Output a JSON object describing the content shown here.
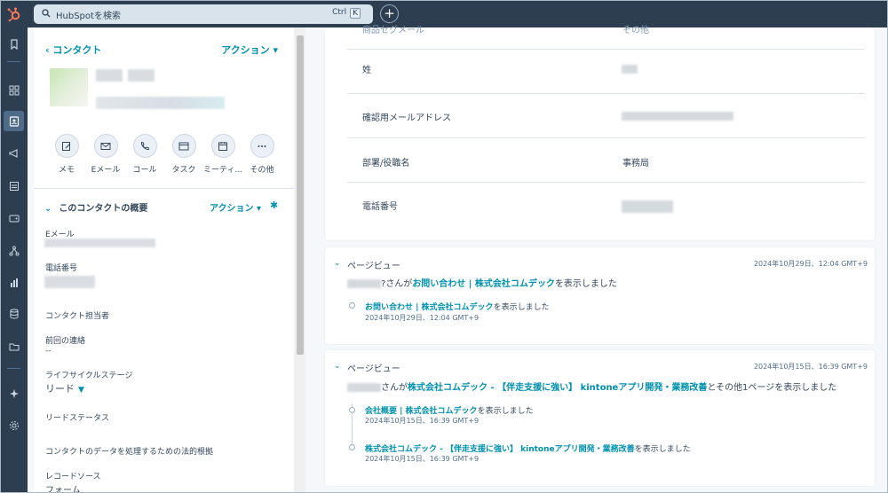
{
  "topbar": {
    "search_placeholder": "HubSpotを検索",
    "shortcut_ctrl": "Ctrl",
    "shortcut_key": "K",
    "add_label": "+"
  },
  "contact": {
    "back_label": "‹ コンタクト",
    "actions_label": "アクション ▾",
    "quick_actions": [
      {
        "label": "メモ",
        "icon": "pencil-icon"
      },
      {
        "label": "Eメール",
        "icon": "envelope-icon"
      },
      {
        "label": "コール",
        "icon": "phone-icon"
      },
      {
        "label": "タスク",
        "icon": "task-icon"
      },
      {
        "label": "ミーティ...",
        "icon": "calendar-icon"
      },
      {
        "label": "その他",
        "icon": "more-icon"
      }
    ]
  },
  "summary": {
    "title": "このコンタクトの概要",
    "actions_label": "アクション ▾",
    "props": {
      "email_label": "Eメール",
      "phone_label": "電話番号",
      "owner_label": "コンタクト担当者",
      "last_contact_label": "前回の連絡",
      "last_contact_value": "--",
      "lifecycle_label": "ライフサイクルステージ",
      "lifecycle_value": "リード",
      "lead_status_label": "リードステータス",
      "legal_basis_label": "コンタクトのデータを処理するための法的根拠",
      "record_source_label": "レコードソース",
      "record_source_value": "フォーム"
    }
  },
  "details": {
    "top_label": "商品セグメール",
    "top_value": "その他",
    "rows": [
      {
        "label": "姓"
      },
      {
        "label": "確認用メールアドレス"
      },
      {
        "label": "部署/役職名",
        "value": "事務局"
      },
      {
        "label": "電話番号"
      }
    ]
  },
  "events": [
    {
      "title": "ページビュー",
      "date": "2024年10月29日、12:04 GMT+9",
      "summary_mid": "さんが",
      "summary_link": "お問い合わせ | 株式会社コムデック",
      "summary_tail": "を表示しました",
      "summary_prefix": "?",
      "items": [
        {
          "link": "お問い合わせ | 株式会社コムデック",
          "tail": "を表示しました",
          "time": "2024年10月29日、12:04 GMT+9"
        }
      ]
    },
    {
      "title": "ページビュー",
      "date": "2024年10月15日、16:39 GMT+9",
      "summary_mid": "さんが",
      "summary_link": "株式会社コムデック - 【伴走支援に強い】 kintoneアプリ開発・業務改善",
      "summary_tail": "とその他1ページを表示しました",
      "items": [
        {
          "link": "会社概要 | 株式会社コムデック",
          "tail": "を表示しました",
          "time": "2024年10月15日、16:39 GMT+9"
        },
        {
          "link": "株式会社コムデック - 【伴走支援に強い】 kintoneアプリ開発・業務改善",
          "tail": "を表示しました",
          "time": "2024年10月15日、16:39 GMT+9"
        }
      ]
    }
  ],
  "colors": {
    "nav_bg": "#2d3e50",
    "accent": "#0091ae",
    "text": "#33475b",
    "page_bg": "#f5f8fa"
  }
}
